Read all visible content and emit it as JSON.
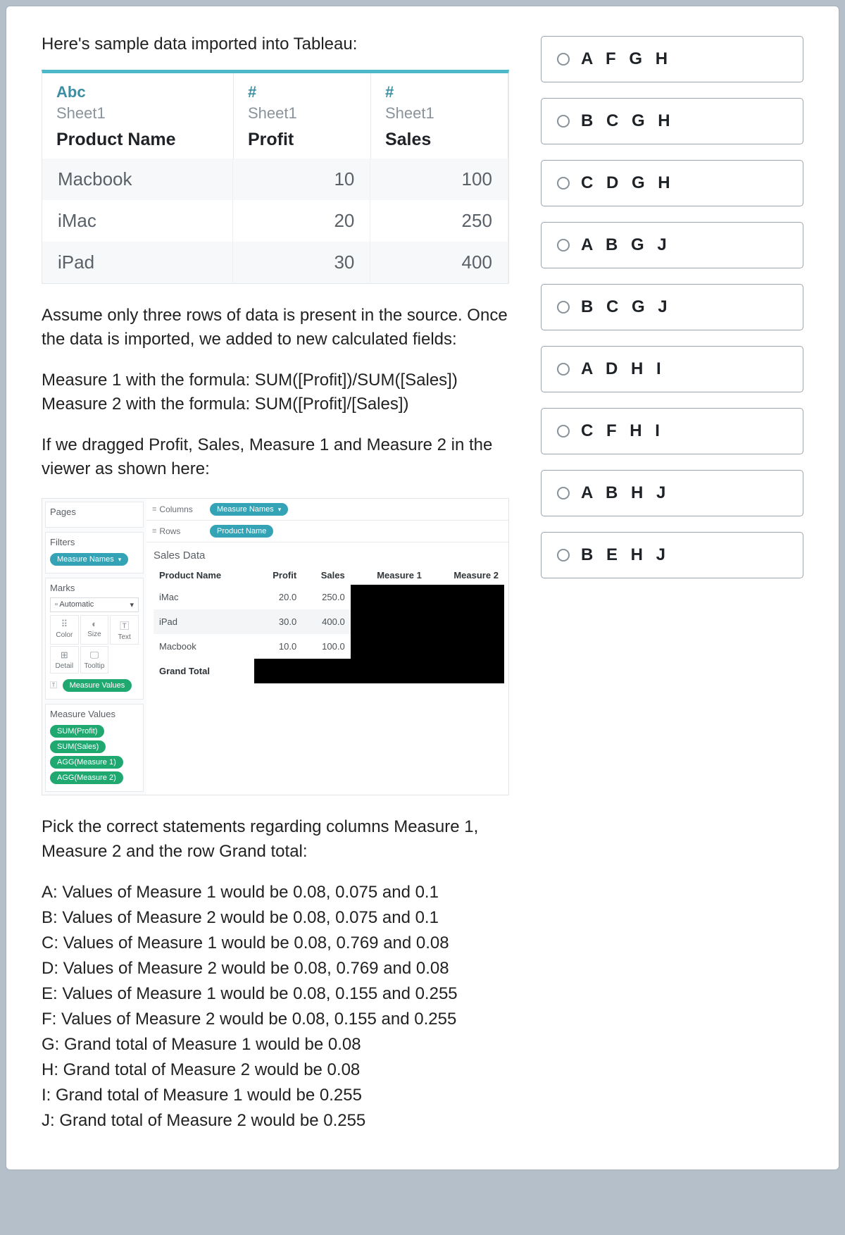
{
  "intro": "Here's sample data imported into Tableau:",
  "tableau_preview": {
    "icons": [
      "Abc",
      "#",
      "#"
    ],
    "sheet": "Sheet1",
    "columns": [
      "Product Name",
      "Profit",
      "Sales"
    ],
    "rows": [
      {
        "name": "Macbook",
        "profit": "10",
        "sales": "100"
      },
      {
        "name": "iMac",
        "profit": "20",
        "sales": "250"
      },
      {
        "name": "iPad",
        "profit": "30",
        "sales": "400"
      }
    ]
  },
  "para1": "Assume only three rows of data is present in the source. Once the data is imported, we added to new calculated fields:",
  "formula1": "Measure 1 with the formula: SUM([Profit])/SUM([Sales])",
  "formula2": "Measure 2 with the formula: SUM([Profit]/[Sales])",
  "para2": "If we dragged Profit, Sales, Measure 1 and Measure 2 in the viewer as shown here:",
  "worksheet": {
    "pages_label": "Pages",
    "filters_label": "Filters",
    "filters_pill": "Measure Names",
    "marks_label": "Marks",
    "marks_auto": "Automatic",
    "marks_cells": [
      "Color",
      "Size",
      "Text",
      "Detail",
      "Tooltip"
    ],
    "marks_pill": "Measure Values",
    "mv_label": "Measure Values",
    "mv_pills": [
      "SUM(Profit)",
      "SUM(Sales)",
      "AGG(Measure 1)",
      "AGG(Measure 2)"
    ],
    "columns_label": "Columns",
    "columns_pill": "Measure Names",
    "rows_label": "Rows",
    "rows_pill": "Product Name",
    "viz_title": "Sales Data",
    "viz_headers": [
      "Product Name",
      "Profit",
      "Sales",
      "Measure 1",
      "Measure 2"
    ],
    "viz_rows": [
      {
        "name": "iMac",
        "profit": "20.0",
        "sales": "250.0"
      },
      {
        "name": "iPad",
        "profit": "30.0",
        "sales": "400.0"
      },
      {
        "name": "Macbook",
        "profit": "10.0",
        "sales": "100.0"
      }
    ],
    "grand_total": "Grand Total"
  },
  "question": "Pick the correct statements regarding columns Measure 1, Measure 2 and the row Grand total:",
  "statements": [
    "A: Values of Measure 1 would be 0.08, 0.075 and 0.1",
    "B: Values of Measure 2 would be 0.08, 0.075 and 0.1",
    "C: Values of Measure 1 would be 0.08, 0.769 and 0.08",
    "D: Values of Measure 2 would be 0.08, 0.769 and 0.08",
    "E: Values of Measure 1 would be 0.08, 0.155 and 0.255",
    "F: Values of Measure 2 would be 0.08, 0.155 and 0.255",
    "G: Grand total of Measure 1 would be 0.08",
    "H: Grand total of Measure 2 would be 0.08",
    "I: Grand total of Measure 1 would be 0.255",
    "J: Grand total of Measure 2 would be 0.255"
  ],
  "options": [
    "A F G H",
    "B C G H",
    "C D G H",
    "A B G J",
    "B C G J",
    "A D H I",
    "C F H I",
    "A B H J",
    "B E H J"
  ]
}
